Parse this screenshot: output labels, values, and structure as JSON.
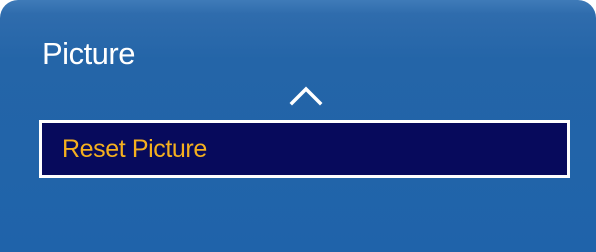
{
  "menu": {
    "title": "Picture",
    "scroll_indicator_icon": "chevron-up-icon",
    "items": [
      {
        "label": "Reset Picture",
        "selected": true
      }
    ]
  },
  "colors": {
    "panel_background": "#2465a8",
    "selected_background": "#070a5c",
    "selected_border": "#ffffff",
    "selected_text": "#f5b01e",
    "title_text": "#ffffff"
  }
}
